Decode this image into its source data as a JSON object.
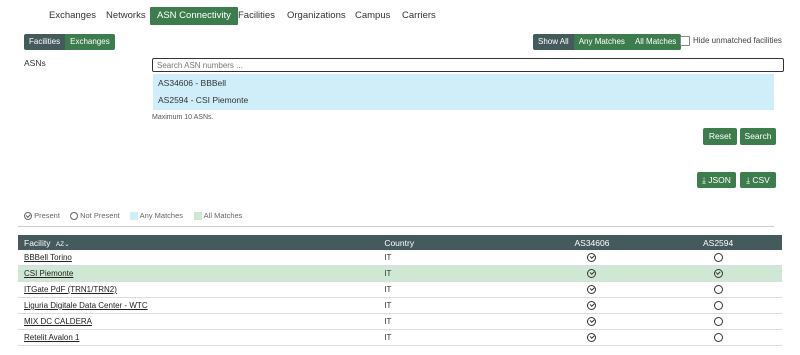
{
  "nav": {
    "tabs": [
      {
        "label": "Exchanges"
      },
      {
        "label": "Networks"
      },
      {
        "label": "ASN Connectivity"
      },
      {
        "label": "Facilities"
      },
      {
        "label": "Organizations"
      },
      {
        "label": "Campus"
      },
      {
        "label": "Carriers"
      }
    ],
    "active_tab": "ASN Connectivity"
  },
  "mode_toggle": {
    "facilities": "Facilities",
    "exchanges": "Exchanges",
    "selected": "Facilities"
  },
  "filter": {
    "show_all": "Show All",
    "any_matches": "Any Matches",
    "all_matches": "All Matches",
    "selected": "Show All"
  },
  "hide_unmatched": {
    "label": "Hide unmatched facilities",
    "checked": false
  },
  "asns": {
    "label": "ASNs",
    "placeholder": "Search ASN numbers ...",
    "selected": [
      "AS34606 - BBBell",
      "AS2594 - CSI Piemonte"
    ],
    "hint": "Maximum 10 ASNs."
  },
  "actions": {
    "reset": "Reset",
    "search": "Search"
  },
  "export": {
    "json": "JSON",
    "csv": "CSV"
  },
  "legend": {
    "present": "Present",
    "not_present": "Not Present",
    "any_matches": "Any Matches",
    "all_matches": "All Matches"
  },
  "colors": {
    "accent_green": "#3d7d4d",
    "header_slate": "#455a5c",
    "any_match_bg": "#cfeefa",
    "all_match_bg": "#cfe8d4"
  },
  "table": {
    "columns": {
      "facility": "Facility",
      "sort_icon": "AZ",
      "country": "Country",
      "asn1": "AS34606",
      "asn2": "AS2594"
    },
    "rows": [
      {
        "facility": "BBBell Torino",
        "country": "IT",
        "as34606": true,
        "as2594": false,
        "all_match": false
      },
      {
        "facility": "CSI Piemonte",
        "country": "IT",
        "as34606": true,
        "as2594": true,
        "all_match": true
      },
      {
        "facility": "ITGate PdF (TRN1/TRN2)",
        "country": "IT",
        "as34606": true,
        "as2594": false,
        "all_match": false
      },
      {
        "facility": "Liguria Digitale Data Center - WTC",
        "country": "IT",
        "as34606": true,
        "as2594": false,
        "all_match": false
      },
      {
        "facility": "MIX DC CALDERA",
        "country": "IT",
        "as34606": true,
        "as2594": false,
        "all_match": false
      },
      {
        "facility": "Retelit Avalon 1",
        "country": "IT",
        "as34606": true,
        "as2594": false,
        "all_match": false
      }
    ]
  }
}
